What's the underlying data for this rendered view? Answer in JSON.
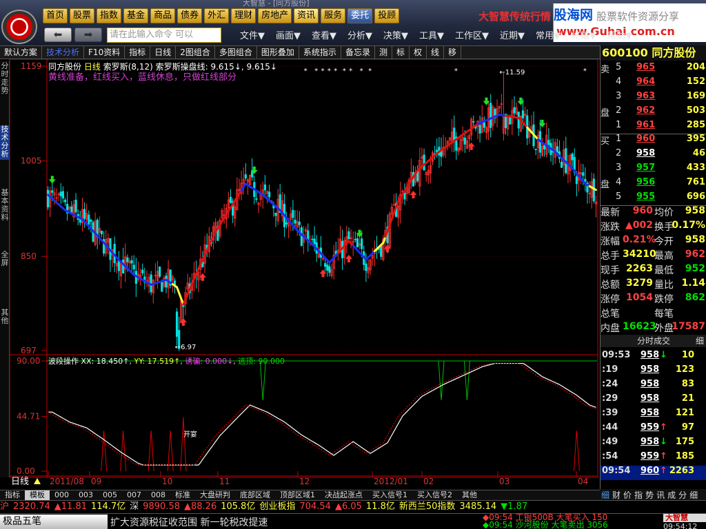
{
  "window": {
    "title": "大智慧 - [同方股份]"
  },
  "menu_top": [
    "首页",
    "股票",
    "指数",
    "基金",
    "商品",
    "债券",
    "外汇",
    "理财",
    "房地产",
    "资讯",
    "服务",
    "委托",
    "投顾"
  ],
  "brand_text": "大智慧传统行情",
  "watermark": {
    "site_cn": "股海网",
    "site_cn2": "股票软件资源分享",
    "url": "www.Guhai.com.cn"
  },
  "command_input": {
    "placeholder": "请在此输入命令    可以"
  },
  "menu_second": [
    "文件▼",
    "画面▼",
    "查看▼",
    "分析▼",
    "决策▼",
    "工具▼",
    "工作区▼",
    "近期▼",
    "常用▼",
    "终端▼",
    "帮助▼"
  ],
  "toolbar": [
    "默认方案",
    "技术分析",
    "F10资料",
    "指标",
    "日线",
    "2图组合",
    "多图组合",
    "图形叠加",
    "系统指示",
    "备忘录",
    "测",
    "标",
    "权",
    "线",
    "移"
  ],
  "left_tabs": [
    "分时走势",
    "技术分析",
    "基本资料",
    "全屏",
    "其他"
  ],
  "chart_header": {
    "stock": "同方股份",
    "period": "日线",
    "indicator": "索罗斯(8,12)",
    "line_label": "索罗斯操盘线: 9.615↓, 9.615↓",
    "note": "黄线准备，红线买入，蓝线休息，只做红线部分"
  },
  "indicator_header": {
    "name": "波段操作",
    "xx": "XX: 18.450↑",
    "yy": "YY: 17.519↑",
    "lure": "诱骗: 0.000↓",
    "escape": "逃顶: 90.000"
  },
  "chart_labels": {
    "high": "←11.59",
    "low": "←6.97",
    "entry": "开宴"
  },
  "colors": {
    "up": "#ff3030",
    "down": "#00e0e0",
    "buy_line": "#e01010",
    "rest_line": "#1c2cf0",
    "ready_line": "#ffff40",
    "frame": "#c00000"
  },
  "bottom_tabs": [
    "指标",
    "模板",
    "000",
    "003",
    "005",
    "007",
    "008",
    "标准",
    "大盘研判",
    "底部区域",
    "顶部区域1",
    "决战起涨点",
    "买入信号1",
    "买入信号2",
    "其他"
  ],
  "stock_panel": {
    "code_name": "600100 同方股份",
    "sell": [
      {
        "side": "卖",
        "lvl": "5",
        "px": "965",
        "vol": "204"
      },
      {
        "side": "",
        "lvl": "4",
        "px": "964",
        "vol": "152"
      },
      {
        "side": "",
        "lvl": "3",
        "px": "963",
        "vol": "169"
      },
      {
        "side": "盘",
        "lvl": "2",
        "px": "962",
        "vol": "503"
      },
      {
        "side": "",
        "lvl": "1",
        "px": "961",
        "vol": "285"
      }
    ],
    "buy": [
      {
        "side": "买",
        "lvl": "1",
        "px": "960",
        "vol": "395"
      },
      {
        "side": "",
        "lvl": "2",
        "px": "958",
        "vol": "46"
      },
      {
        "side": "",
        "lvl": "3",
        "px": "957",
        "vol": "433"
      },
      {
        "side": "盘",
        "lvl": "4",
        "px": "956",
        "vol": "761"
      },
      {
        "side": "",
        "lvl": "5",
        "px": "955",
        "vol": "696"
      }
    ],
    "stats": [
      {
        "k1": "最新",
        "v1": "960",
        "k2": "均价",
        "v2": "958",
        "c1": "#ff4040",
        "c2": "#ffff40"
      },
      {
        "k1": "涨跌",
        "v1": "▲002",
        "k2": "换手",
        "v2": "0.17%",
        "c1": "#ff4040",
        "c2": "#ffff40"
      },
      {
        "k1": "涨幅",
        "v1": "0.21%",
        "k2": "今开",
        "v2": "958",
        "c1": "#ff4040",
        "c2": "#ffff40"
      },
      {
        "k1": "总手",
        "v1": "34210",
        "k2": "最高",
        "v2": "962",
        "c1": "#ffff40",
        "c2": "#ff4040"
      },
      {
        "k1": "现手",
        "v1": "2263",
        "k2": "最低",
        "v2": "952",
        "c1": "#ffff40",
        "c2": "#00e000"
      },
      {
        "k1": "总额",
        "v1": "3279",
        "k2": "量比",
        "v2": "1.14",
        "c1": "#ffff40",
        "c2": "#ffff40"
      },
      {
        "k1": "涨停",
        "v1": "1054",
        "k2": "跌停",
        "v2": "862",
        "c1": "#ff4040",
        "c2": "#00e000"
      },
      {
        "k1": "总笔",
        "v1": "",
        "k2": "每笔",
        "v2": "",
        "c1": "#ffff40",
        "c2": "#ffff40"
      },
      {
        "k1": "内盘",
        "v1": "16623",
        "k2": "外盘",
        "v2": "17587",
        "c1": "#00e000",
        "c2": "#ff4040"
      }
    ],
    "ticks_title": "分时成交",
    "ticks_fine": "细",
    "ticks": [
      {
        "t": "09:53",
        "p": "958",
        "a": "↓",
        "ac": "#00e000",
        "v": "10"
      },
      {
        "t": ":19",
        "p": "958",
        "a": "",
        "ac": "#fff",
        "v": "123"
      },
      {
        "t": ":24",
        "p": "958",
        "a": "",
        "ac": "#fff",
        "v": "83"
      },
      {
        "t": ":29",
        "p": "958",
        "a": "",
        "ac": "#fff",
        "v": "21"
      },
      {
        "t": ":39",
        "p": "958",
        "a": "",
        "ac": "#fff",
        "v": "121"
      },
      {
        "t": ":44",
        "p": "959",
        "a": "↑",
        "ac": "#ff4040",
        "v": "97"
      },
      {
        "t": ":49",
        "p": "958",
        "a": "↓",
        "ac": "#00e000",
        "v": "175"
      },
      {
        "t": ":54",
        "p": "959",
        "a": "↑",
        "ac": "#ff4040",
        "v": "185"
      },
      {
        "t": "09:54",
        "p": "960",
        "a": "↑",
        "ac": "#ff4040",
        "v": "2263"
      }
    ],
    "tabs": [
      "细",
      "财",
      "价",
      "指",
      "势",
      "讯",
      "成",
      "分",
      "细"
    ]
  },
  "ticker_row": [
    {
      "t": "沪",
      "c": "#ff4040"
    },
    {
      "t": "2320.74",
      "c": "#ff4040"
    },
    {
      "t": "▲11.81",
      "c": "#ff4040"
    },
    {
      "t": "114.7亿",
      "c": "#ffff40"
    },
    {
      "t": "深",
      "c": "#ddd"
    },
    {
      "t": "9890.58",
      "c": "#ff4040"
    },
    {
      "t": "▲88.26",
      "c": "#ff4040"
    },
    {
      "t": "105.8亿",
      "c": "#ffff40"
    },
    {
      "t": "创业板指",
      "c": "#ffff40"
    },
    {
      "t": "704.54",
      "c": "#ff4040"
    },
    {
      "t": "▲6.05",
      "c": "#ff4040"
    },
    {
      "t": "11.8亿",
      "c": "#ffff40"
    },
    {
      "t": "新西兰50指数",
      "c": "#ffff40"
    },
    {
      "t": "3485.14",
      "c": "#ffff40"
    },
    {
      "t": "▼1.87",
      "c": "#00e000"
    }
  ],
  "status_bar": {
    "button": "极品五笔",
    "news": "扩大资源税征收范围 新一轮税改提速",
    "alert1": "◆09:54 工银500B 大笔买入 150",
    "alert2": "◆09:54 沙河股份 大笔卖出 3056",
    "time": "09:54:12"
  },
  "chart_data": {
    "type": "candlestick",
    "title": "同方股份 日线",
    "y_ticks": [
      "1159",
      "1005",
      "850",
      "697"
    ],
    "y_ticks_values": [
      1159,
      1005,
      850,
      697
    ],
    "ylim": [
      697,
      1159
    ],
    "x_ticks": [
      "2011/08",
      "09",
      "10",
      "11",
      "12",
      "2012/01",
      "02",
      "03",
      "04"
    ],
    "price_line": [
      {
        "x": 0,
        "y": 950
      },
      {
        "x": 8,
        "y": 925
      },
      {
        "x": 16,
        "y": 910
      },
      {
        "x": 24,
        "y": 880
      },
      {
        "x": 32,
        "y": 848
      },
      {
        "x": 40,
        "y": 820
      },
      {
        "x": 48,
        "y": 804
      },
      {
        "x": 55,
        "y": 812
      },
      {
        "x": 60,
        "y": 800
      },
      {
        "x": 63,
        "y": 772
      },
      {
        "x": 70,
        "y": 830
      },
      {
        "x": 78,
        "y": 890
      },
      {
        "x": 86,
        "y": 935
      },
      {
        "x": 92,
        "y": 968
      },
      {
        "x": 100,
        "y": 950
      },
      {
        "x": 108,
        "y": 925
      },
      {
        "x": 116,
        "y": 892
      },
      {
        "x": 124,
        "y": 866
      },
      {
        "x": 131,
        "y": 840
      },
      {
        "x": 140,
        "y": 875
      },
      {
        "x": 148,
        "y": 845
      },
      {
        "x": 156,
        "y": 872
      },
      {
        "x": 163,
        "y": 940
      },
      {
        "x": 172,
        "y": 990
      },
      {
        "x": 182,
        "y": 1020
      },
      {
        "x": 192,
        "y": 1045
      },
      {
        "x": 200,
        "y": 1065
      },
      {
        "x": 210,
        "y": 1080
      },
      {
        "x": 219,
        "y": 1075
      },
      {
        "x": 228,
        "y": 1040
      },
      {
        "x": 236,
        "y": 1020
      },
      {
        "x": 244,
        "y": 993
      },
      {
        "x": 250,
        "y": 968
      },
      {
        "x": 255,
        "y": 958
      }
    ],
    "oscillator_ylim": [
      0,
      90
    ],
    "oscillator_ticks": [
      "90.00",
      "44.71",
      "0.00"
    ]
  }
}
